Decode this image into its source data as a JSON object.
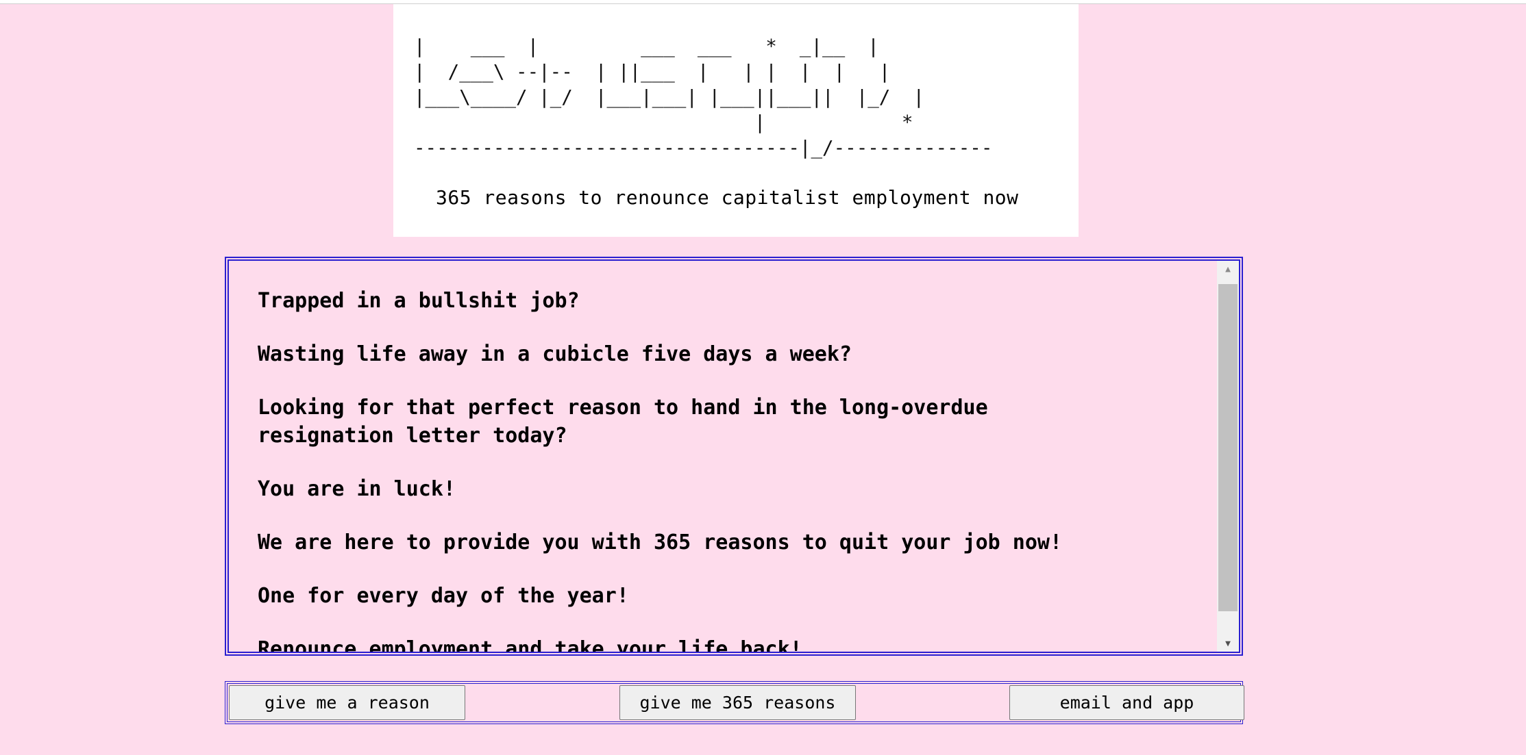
{
  "header": {
    "ascii_logo": "|    ___  |         ___  ___   *  _|__  |\n|  /___\\ --|--  | ||___  |   | |  |  |   |\n|___\\____/ |_/  |___|___| |___||___||  |_/  |\n                              |            *\n----------------------------------|_/--------------",
    "subtitle": "365 reasons to renounce capitalist employment now"
  },
  "message": {
    "lines": [
      "Trapped in a bullshit job?",
      "Wasting life away in a cubicle five days a week?",
      "Looking for that perfect reason to hand in the long-overdue\nresignation letter today?",
      "You are in luck!",
      "We are here to provide you with 365 reasons to quit your job now!",
      "One for every day of the year!",
      "Renounce employment and take your life back!"
    ]
  },
  "buttons": {
    "reason": "give me a reason",
    "all_reasons": "give me 365 reasons",
    "email_app": "email and app"
  },
  "colors": {
    "background": "#fedcec",
    "frame_border": "#2a1fd0",
    "card": "#ffffff"
  },
  "icons": {
    "scroll_up": "scroll-up-arrow-icon",
    "scroll_down": "scroll-down-arrow-icon"
  }
}
